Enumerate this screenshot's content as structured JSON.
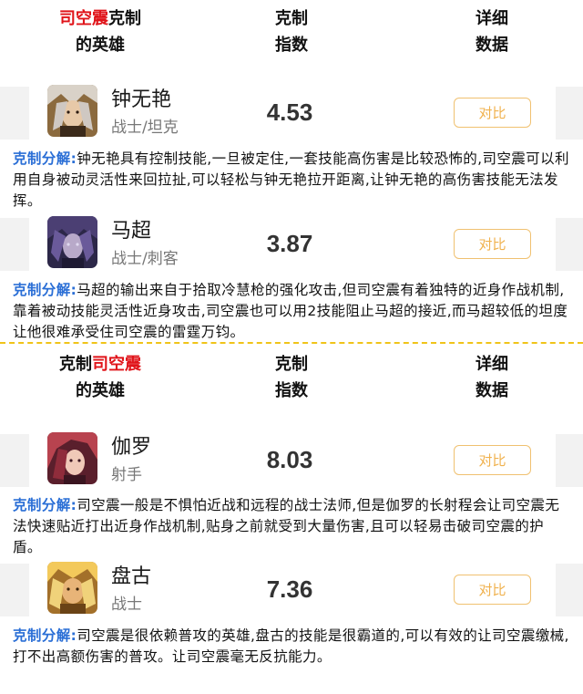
{
  "section1": {
    "header": {
      "col1_red": "司空震",
      "col1_rest": "克制",
      "col1_line2": "的英雄",
      "col2_line1": "克制",
      "col2_line2": "指数",
      "col3_line1": "详细",
      "col3_line2": "数据"
    },
    "heroes": [
      {
        "name": "钟无艳",
        "role": "战士/坦克",
        "score": "4.53",
        "button": "对比",
        "desc_label": "克制分解:",
        "desc": "钟无艳具有控制技能,一旦被定住,一套技能高伤害是比较恐怖的,司空震可以利用自身被动灵活性来回拉扯,可以轻松与钟无艳拉开距离,让钟无艳的高伤害技能无法发挥。"
      },
      {
        "name": "马超",
        "role": "战士/刺客",
        "score": "3.87",
        "button": "对比",
        "desc_label": "克制分解:",
        "desc": "马超的输出来自于拾取冷慧枪的强化攻击,但司空震有着独特的近身作战机制,靠着被动技能灵活性近身攻击,司空震也可以用2技能阻止马超的接近,而马超较低的坦度让他很难承受住司空震的雷霆万钧。"
      }
    ]
  },
  "section2": {
    "header": {
      "col1_rest": "克制",
      "col1_red": "司空震",
      "col1_line2": "的英雄",
      "col2_line1": "克制",
      "col2_line2": "指数",
      "col3_line1": "详细",
      "col3_line2": "数据"
    },
    "heroes": [
      {
        "name": "伽罗",
        "role": "射手",
        "score": "8.03",
        "button": "对比",
        "desc_label": "克制分解:",
        "desc": "司空震一般是不惧怕近战和远程的战士法师,但是伽罗的长射程会让司空震无法快速贴近打出近身作战机制,贴身之前就受到大量伤害,且可以轻易击破司空震的护盾。"
      },
      {
        "name": "盘古",
        "role": "战士",
        "score": "7.36",
        "button": "对比",
        "desc_label": "克制分解:",
        "desc": "司空震是很依赖普攻的英雄,盘古的技能是很霸道的,可以有效的让司空震缴械,打不出高额伤害的普攻。让司空震毫无反抗能力。"
      }
    ]
  },
  "colors": {
    "red": "#e0141a",
    "label_blue": "#2b6fd6",
    "button_gold": "#f0b14d",
    "divider_yellow": "#f0c419"
  },
  "icons": [
    "avatar-zhongwuyan",
    "avatar-machao",
    "avatar-jialuo",
    "avatar-pangu"
  ]
}
